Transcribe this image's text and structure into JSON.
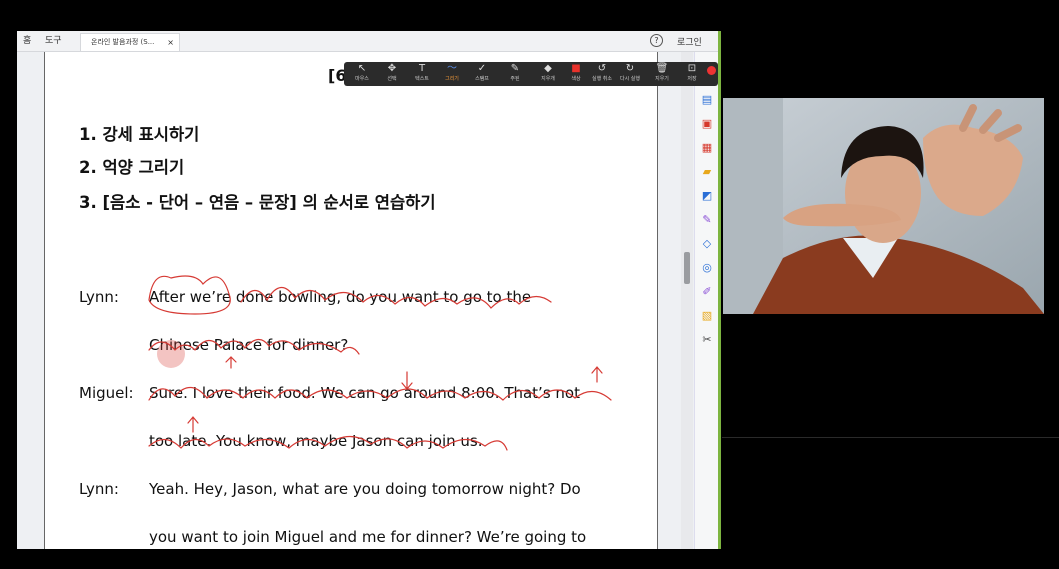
{
  "tabbar": {
    "home": "홈",
    "tools": "도구",
    "doc_tab": "온라인 발음과정 (S...",
    "doc_tab_close": "×",
    "help": "?",
    "login": "로그인"
  },
  "toolbar": {
    "tools": [
      {
        "label": "마우스",
        "icon": "↖"
      },
      {
        "label": "선택",
        "icon": "✥"
      },
      {
        "label": "텍스트",
        "icon": "T"
      },
      {
        "label": "그리기",
        "icon": "〜"
      },
      {
        "label": "스탬프",
        "icon": "✓"
      },
      {
        "label": "주된",
        "icon": "✎"
      },
      {
        "label": "지우개",
        "icon": "◆"
      },
      {
        "label": "색상",
        "icon": "■"
      },
      {
        "label": "실행 취소",
        "icon": "↺"
      },
      {
        "label": "다시 실행",
        "icon": "↻"
      },
      {
        "label": "지우기",
        "icon": "🗑"
      },
      {
        "label": "저장",
        "icon": "⊡"
      }
    ],
    "active_index": 3,
    "accent": "#f39a3a",
    "color_swatch": "#e8322b"
  },
  "page": {
    "page_number": "[6 ]",
    "headings": [
      "1. 강세 표시하기",
      "2. 억양 그리기",
      "3. [음소 - 단어 – 연음 – 문장] 의 순서로 연습하기"
    ],
    "dialogue": [
      {
        "speaker": "Lynn:",
        "lines": [
          "After we’re done bowling, do you want to go to the",
          "Chinese Palace for dinner?"
        ]
      },
      {
        "speaker": "Miguel:",
        "lines": [
          "Sure. I love their food. We can go around 8:00. That’s not",
          "too late. You know, maybe Jason can join us."
        ]
      },
      {
        "speaker": "Lynn:",
        "lines": [
          "Yeah. Hey, Jason, what are you doing tomorrow night? Do",
          "you want to join Miguel and me for dinner? We’re going to"
        ]
      }
    ],
    "annotation_color": "#d63a34"
  }
}
